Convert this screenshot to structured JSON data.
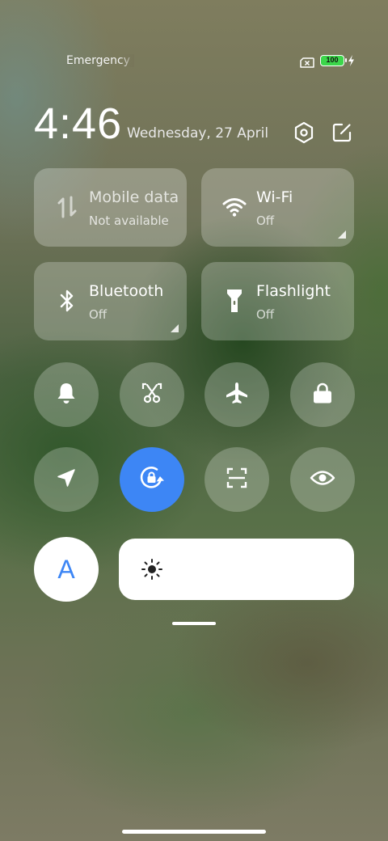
{
  "status_bar": {
    "carrier_text": "Emergency calls only",
    "sim_icon": "no-sim-icon",
    "battery_level": "100",
    "battery_color": "#3cd64a",
    "charging_icon": "bolt-icon"
  },
  "header": {
    "time": "4:46",
    "date": "Wednesday, 27 April",
    "settings_icon": "settings-icon",
    "edit_icon": "edit-icon"
  },
  "tiles": {
    "mobile_data": {
      "label": "Mobile data",
      "status": "Not available",
      "icon": "mobile-data-icon"
    },
    "wifi": {
      "label": "Wi-Fi",
      "status": "Off",
      "icon": "wifi-icon"
    },
    "bluetooth": {
      "label": "Bluetooth",
      "status": "Off",
      "icon": "bluetooth-icon"
    },
    "flashlight": {
      "label": "Flashlight",
      "status": "Off",
      "icon": "flashlight-icon"
    }
  },
  "toggles": [
    {
      "name": "silent",
      "icon": "bell-icon",
      "active": false
    },
    {
      "name": "screenshot",
      "icon": "scissors-icon",
      "active": false
    },
    {
      "name": "airplane-mode",
      "icon": "airplane-icon",
      "active": false
    },
    {
      "name": "lock-screen",
      "icon": "lock-icon",
      "active": false
    },
    {
      "name": "location",
      "icon": "location-arrow-icon",
      "active": false
    },
    {
      "name": "rotation-lock",
      "icon": "rotation-lock-icon",
      "active": true
    },
    {
      "name": "scanner",
      "icon": "scan-icon",
      "active": false
    },
    {
      "name": "reading-mode",
      "icon": "eye-icon",
      "active": false
    }
  ],
  "auto_brightness": {
    "label": "A"
  },
  "brightness": {
    "icon": "sun-icon",
    "level": 0.0
  },
  "colors": {
    "accent": "#3d86f5"
  }
}
